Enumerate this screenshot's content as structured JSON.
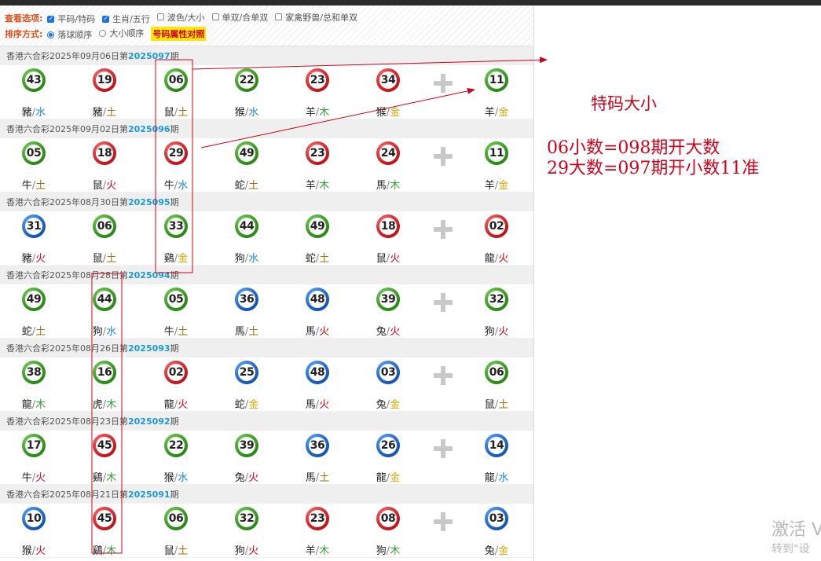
{
  "options": {
    "view_label": "查看选项:",
    "view_items": [
      {
        "label": "平码/特码",
        "checked": true
      },
      {
        "label": "生肖/五行",
        "checked": true
      },
      {
        "label": "波色/大小",
        "checked": false
      },
      {
        "label": "单双/合单双",
        "checked": false
      },
      {
        "label": "家禽野兽/总和单双",
        "checked": false
      }
    ],
    "sort_label": "排序方式:",
    "sort_items": [
      {
        "label": "落球顺序",
        "selected": true
      },
      {
        "label": "大小顺序",
        "selected": false
      }
    ],
    "attr_button": "号码属性对照"
  },
  "draws": [
    {
      "lottery": "香港六合彩",
      "date": "2025年09月06日",
      "prefix": "第",
      "issue": "2025097",
      "suffix": "期",
      "balls": [
        {
          "num": "43",
          "color": "green",
          "zodiac": "豬",
          "element": "水"
        },
        {
          "num": "19",
          "color": "red",
          "zodiac": "豬",
          "element": "土"
        },
        {
          "num": "06",
          "color": "green",
          "zodiac": "鼠",
          "element": "土"
        },
        {
          "num": "22",
          "color": "green",
          "zodiac": "猴",
          "element": "水"
        },
        {
          "num": "23",
          "color": "red",
          "zodiac": "羊",
          "element": "木"
        },
        {
          "num": "34",
          "color": "red",
          "zodiac": "猴",
          "element": "金"
        }
      ],
      "special": {
        "num": "11",
        "color": "green",
        "zodiac": "羊",
        "element": "金"
      }
    },
    {
      "lottery": "香港六合彩",
      "date": "2025年09月02日",
      "prefix": "第",
      "issue": "2025096",
      "suffix": "期",
      "balls": [
        {
          "num": "05",
          "color": "green",
          "zodiac": "牛",
          "element": "土"
        },
        {
          "num": "18",
          "color": "red",
          "zodiac": "鼠",
          "element": "火"
        },
        {
          "num": "29",
          "color": "red",
          "zodiac": "牛",
          "element": "水"
        },
        {
          "num": "49",
          "color": "green",
          "zodiac": "蛇",
          "element": "土"
        },
        {
          "num": "23",
          "color": "red",
          "zodiac": "羊",
          "element": "木"
        },
        {
          "num": "24",
          "color": "red",
          "zodiac": "馬",
          "element": "木"
        }
      ],
      "special": {
        "num": "11",
        "color": "green",
        "zodiac": "羊",
        "element": "金"
      }
    },
    {
      "lottery": "香港六合彩",
      "date": "2025年08月30日",
      "prefix": "第",
      "issue": "2025095",
      "suffix": "期",
      "balls": [
        {
          "num": "31",
          "color": "blue",
          "zodiac": "豬",
          "element": "火"
        },
        {
          "num": "06",
          "color": "green",
          "zodiac": "鼠",
          "element": "土"
        },
        {
          "num": "33",
          "color": "green",
          "zodiac": "鷄",
          "element": "金"
        },
        {
          "num": "44",
          "color": "green",
          "zodiac": "狗",
          "element": "水"
        },
        {
          "num": "49",
          "color": "green",
          "zodiac": "蛇",
          "element": "土"
        },
        {
          "num": "18",
          "color": "red",
          "zodiac": "鼠",
          "element": "火"
        }
      ],
      "special": {
        "num": "02",
        "color": "red",
        "zodiac": "龍",
        "element": "火"
      }
    },
    {
      "lottery": "香港六合彩",
      "date": "2025年08月28日",
      "prefix": "第",
      "issue": "2025094",
      "suffix": "期",
      "balls": [
        {
          "num": "49",
          "color": "green",
          "zodiac": "蛇",
          "element": "土"
        },
        {
          "num": "44",
          "color": "green",
          "zodiac": "狗",
          "element": "水"
        },
        {
          "num": "05",
          "color": "green",
          "zodiac": "牛",
          "element": "土"
        },
        {
          "num": "36",
          "color": "blue",
          "zodiac": "馬",
          "element": "土"
        },
        {
          "num": "48",
          "color": "blue",
          "zodiac": "馬",
          "element": "火"
        },
        {
          "num": "39",
          "color": "green",
          "zodiac": "兔",
          "element": "火"
        }
      ],
      "special": {
        "num": "32",
        "color": "green",
        "zodiac": "狗",
        "element": "火"
      }
    },
    {
      "lottery": "香港六合彩",
      "date": "2025年08月26日",
      "prefix": "第",
      "issue": "2025093",
      "suffix": "期",
      "balls": [
        {
          "num": "38",
          "color": "green",
          "zodiac": "龍",
          "element": "木"
        },
        {
          "num": "16",
          "color": "green",
          "zodiac": "虎",
          "element": "木"
        },
        {
          "num": "02",
          "color": "red",
          "zodiac": "龍",
          "element": "火"
        },
        {
          "num": "25",
          "color": "blue",
          "zodiac": "蛇",
          "element": "金"
        },
        {
          "num": "48",
          "color": "blue",
          "zodiac": "馬",
          "element": "火"
        },
        {
          "num": "03",
          "color": "blue",
          "zodiac": "兔",
          "element": "金"
        }
      ],
      "special": {
        "num": "06",
        "color": "green",
        "zodiac": "鼠",
        "element": "土"
      }
    },
    {
      "lottery": "香港六合彩",
      "date": "2025年08月23日",
      "prefix": "第",
      "issue": "2025092",
      "suffix": "期",
      "balls": [
        {
          "num": "17",
          "color": "green",
          "zodiac": "牛",
          "element": "火"
        },
        {
          "num": "45",
          "color": "red",
          "zodiac": "鷄",
          "element": "木"
        },
        {
          "num": "22",
          "color": "green",
          "zodiac": "猴",
          "element": "水"
        },
        {
          "num": "39",
          "color": "green",
          "zodiac": "兔",
          "element": "火"
        },
        {
          "num": "36",
          "color": "blue",
          "zodiac": "馬",
          "element": "土"
        },
        {
          "num": "26",
          "color": "blue",
          "zodiac": "龍",
          "element": "金"
        }
      ],
      "special": {
        "num": "14",
        "color": "blue",
        "zodiac": "龍",
        "element": "水"
      }
    },
    {
      "lottery": "香港六合彩",
      "date": "2025年08月21日",
      "prefix": "第",
      "issue": "2025091",
      "suffix": "期",
      "balls": [
        {
          "num": "10",
          "color": "blue",
          "zodiac": "猴",
          "element": "火"
        },
        {
          "num": "45",
          "color": "red",
          "zodiac": "鷄",
          "element": "木"
        },
        {
          "num": "06",
          "color": "green",
          "zodiac": "鼠",
          "element": "土"
        },
        {
          "num": "32",
          "color": "green",
          "zodiac": "狗",
          "element": "火"
        },
        {
          "num": "23",
          "color": "red",
          "zodiac": "羊",
          "element": "木"
        },
        {
          "num": "08",
          "color": "red",
          "zodiac": "狗",
          "element": "木"
        }
      ],
      "special": {
        "num": "03",
        "color": "blue",
        "zodiac": "兔",
        "element": "金"
      }
    }
  ],
  "annotation": {
    "title": "特码大小",
    "line1": "06小数=098期开大数",
    "line2": "29大数=097期开小数11准"
  },
  "watermark": {
    "line1": "激活 V",
    "line2": "转到\"设"
  },
  "colors": {
    "red": "#d0021b",
    "green": "#2a8a16",
    "blue": "#1456b8",
    "accent": "#d9531e",
    "issue": "#1a9bd7"
  }
}
